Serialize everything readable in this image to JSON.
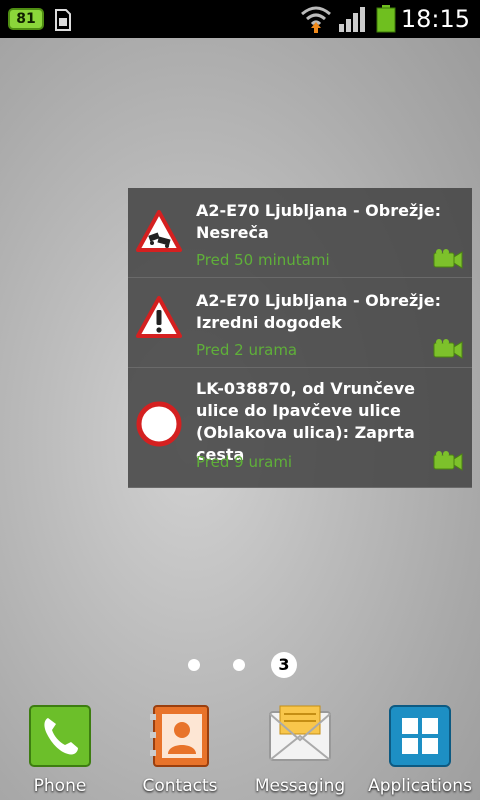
{
  "status_bar": {
    "notification_count": "81",
    "time": "18:15",
    "icons": [
      "sim-icon",
      "wifi-icon",
      "signal-icon",
      "battery-icon"
    ]
  },
  "widget": {
    "items": [
      {
        "title": "A2-E70 Ljubljana - Obrežje: Nesreča",
        "time": "Pred 50 minutami",
        "sign": "accident-warning-sign-icon"
      },
      {
        "title": "A2-E70 Ljubljana - Obrežje: Izredni dogodek",
        "time": "Pred 2 urama",
        "sign": "danger-warning-sign-icon"
      },
      {
        "title": "LK-038870, od Vrunčeve ulice do Ipavčeve ulice (Oblakova ulica): Zaprta cesta",
        "time": "Pred 9 urami",
        "sign": "road-closed-sign-icon"
      }
    ],
    "time_color": "#5fb039"
  },
  "page_indicator": {
    "current": "3"
  },
  "dock": {
    "apps": [
      {
        "label": "Phone",
        "icon": "phone-icon"
      },
      {
        "label": "Contacts",
        "icon": "contacts-icon"
      },
      {
        "label": "Messaging",
        "icon": "messaging-icon"
      },
      {
        "label": "Applications",
        "icon": "applications-grid-icon"
      }
    ]
  }
}
